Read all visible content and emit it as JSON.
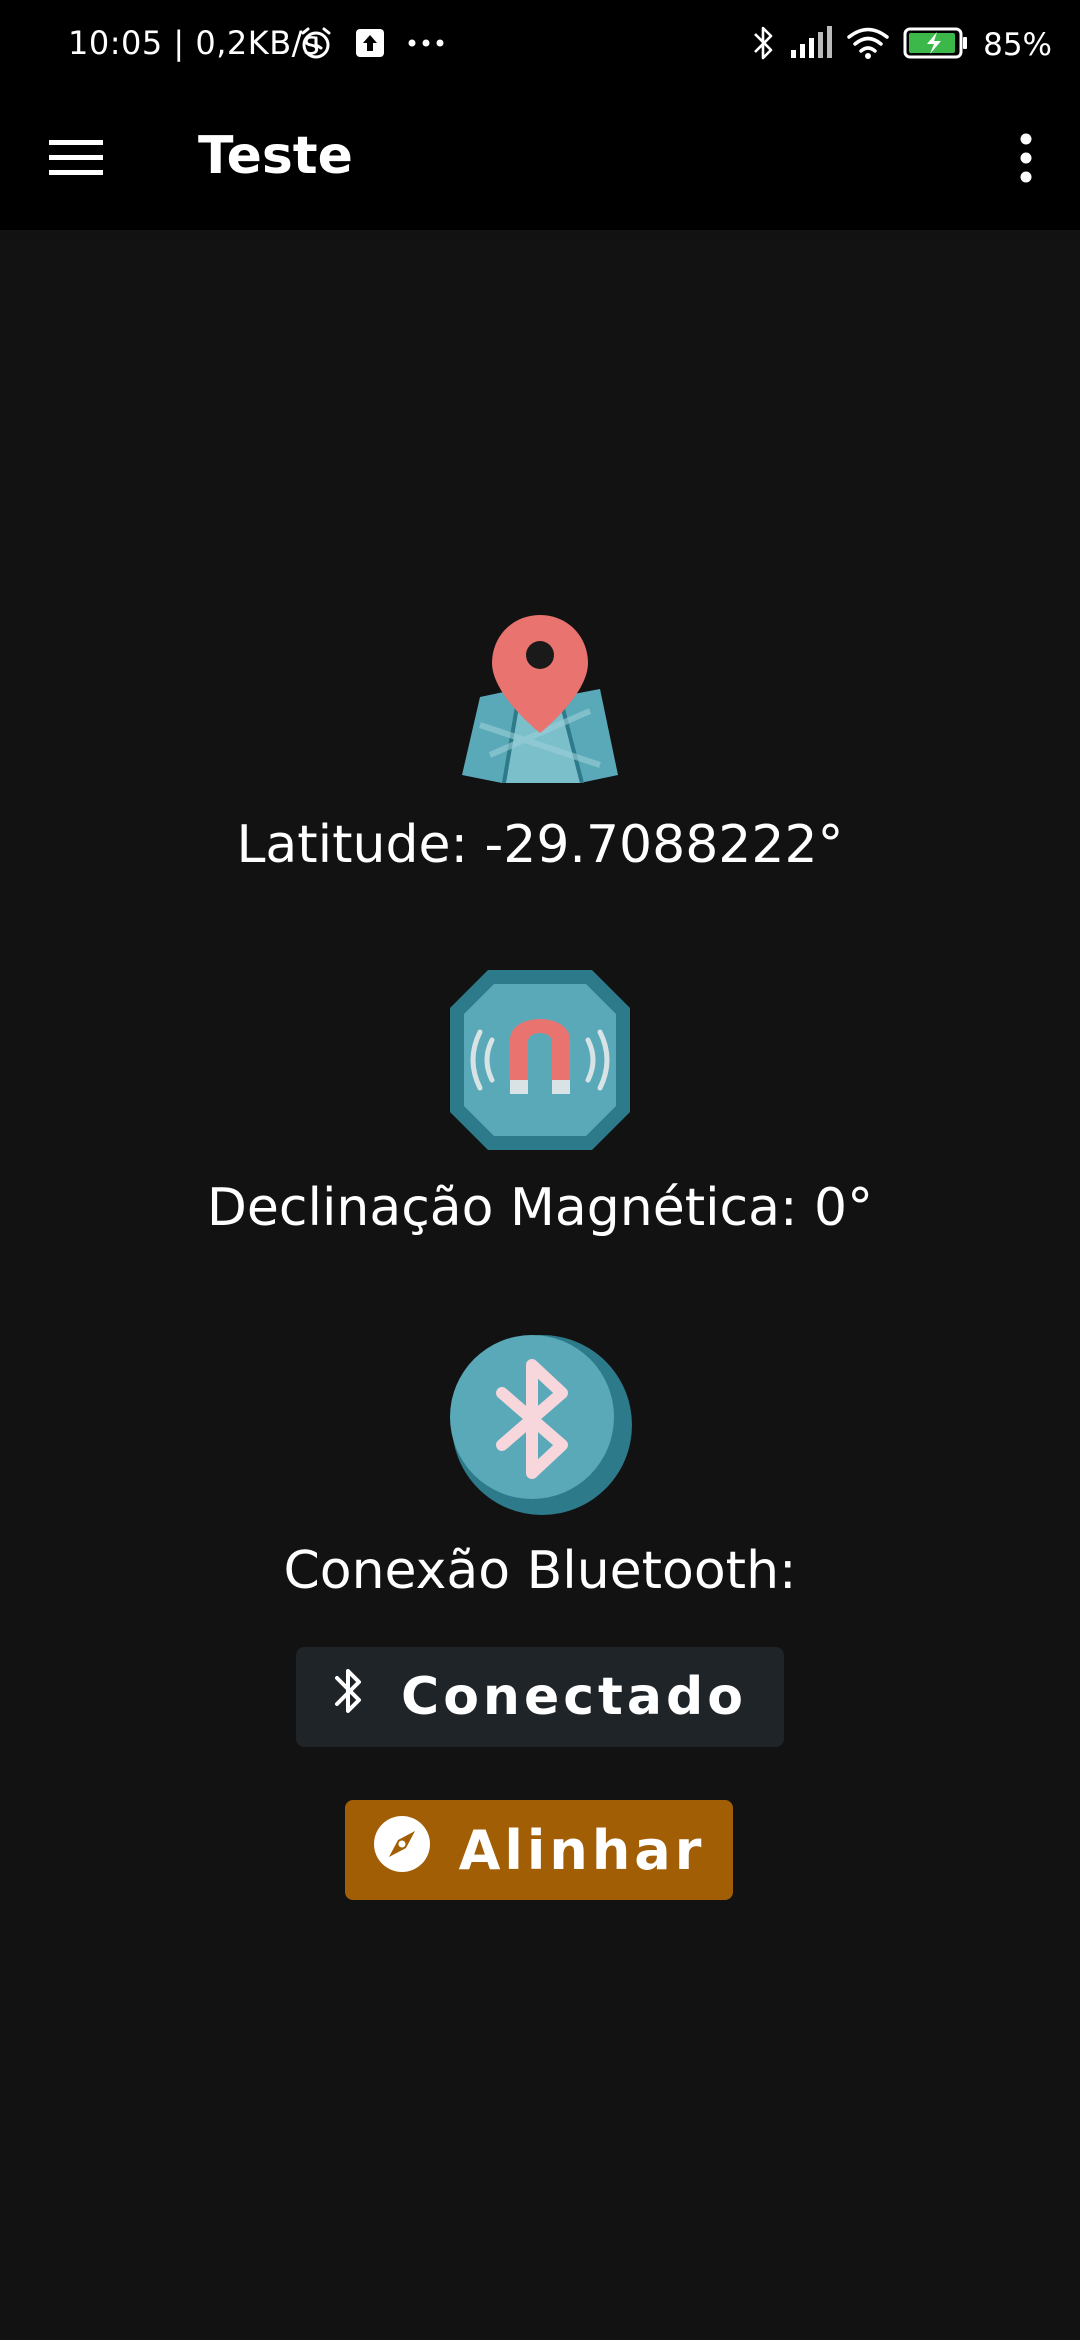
{
  "status_bar": {
    "time": "10:05 | 0,2KB/s",
    "battery_percent": "85%",
    "icons_left": [
      "alarm-icon",
      "upload-icon",
      "more-dots-icon"
    ],
    "icons_right": [
      "bluetooth-icon",
      "signal-icon",
      "wifi-icon",
      "battery-charging-icon"
    ]
  },
  "app_bar": {
    "title": "Teste",
    "menu_icon": "menu-icon",
    "overflow_icon": "overflow-menu-icon",
    "background": "#000000"
  },
  "main": {
    "latitude_label": "Latitude: -29.7088222°",
    "declination_label": "Declinação Magnética: 0°",
    "bluetooth_label": "Conexão Bluetooth:",
    "connect_button_label": "Conectado",
    "align_button_label": "Alinhar",
    "icons": [
      "map-pin-icon",
      "magnet-icon",
      "bluetooth-circle-icon"
    ]
  },
  "colors": {
    "background": "#121212",
    "connect_button": "#1e2427",
    "align_button": "#a15e05",
    "icon_teal": "#5aa9b8",
    "icon_dark_teal": "#2d7a8a",
    "icon_red": "#e8736f"
  }
}
